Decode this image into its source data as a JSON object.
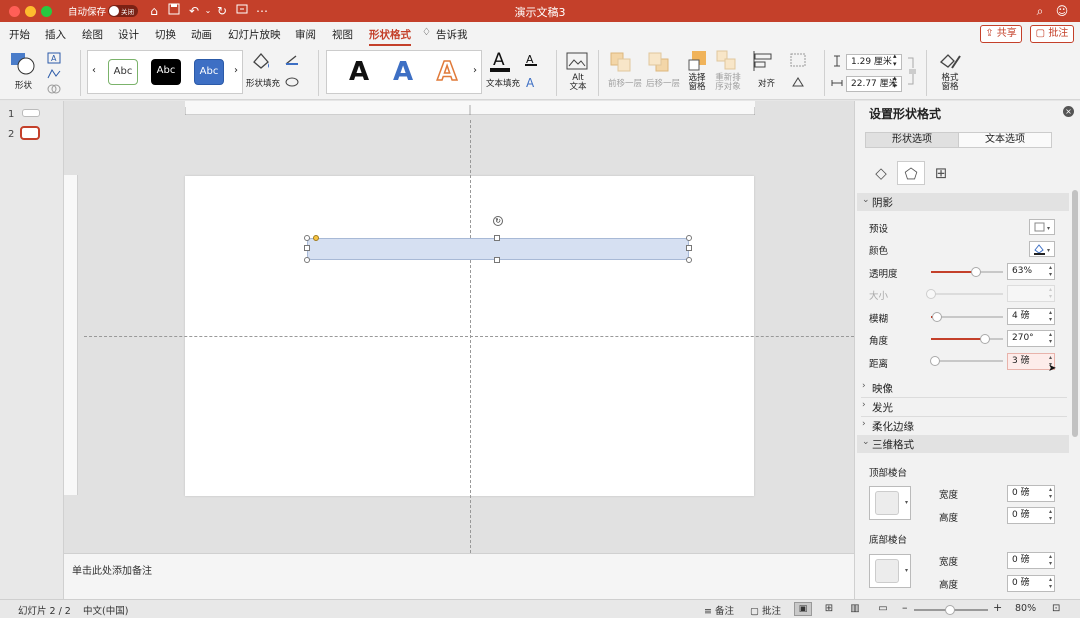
{
  "titlebar": {
    "autosave_label": "自动保存",
    "autosave_state": "关闭",
    "doc_title": "演示文稿3",
    "accent": "#c4402a"
  },
  "menu": {
    "tabs": [
      "开始",
      "插入",
      "绘图",
      "设计",
      "切换",
      "动画",
      "幻灯片放映",
      "审阅",
      "视图",
      "形状格式",
      "告诉我"
    ],
    "active": "形状格式",
    "share_label": "共享",
    "comment_label": "批注"
  },
  "ribbon": {
    "shape_label": "形状",
    "style_samples": [
      "Abc",
      "Abc",
      "Abc"
    ],
    "shape_fill_label": "形状填充",
    "wordart_letter": "A",
    "text_fill_label": "文本填充",
    "alt_text_label": "Alt 文本",
    "forward_label": "前移一层",
    "backward_label": "后移一层",
    "selection_pane_label": "选择 窗格",
    "reorder_label": "重新排 序对象",
    "align_label": "对齐",
    "height_value": "1.29 厘米",
    "width_value": "22.77 厘米",
    "format_pane_label": "格式 窗格"
  },
  "thumbnails": {
    "slides": [
      "1",
      "2"
    ]
  },
  "notes": {
    "placeholder": "单击此处添加备注"
  },
  "status": {
    "slide_info": "幻灯片 2 / 2",
    "language": "中文(中国)",
    "notes_label": "备注",
    "comments_label": "批注",
    "zoom": "80%",
    "zoom_fraction": 0.48
  },
  "panel": {
    "title": "设置形状格式",
    "segments": [
      "形状选项",
      "文本选项"
    ],
    "shadow": {
      "title": "阴影",
      "preset_label": "预设",
      "color_label": "颜色",
      "transparency_label": "透明度",
      "transparency_value": "63%",
      "transparency_fraction": 0.63,
      "size_label": "大小",
      "size_value": "",
      "size_fraction": 0,
      "blur_label": "模糊",
      "blur_value": "4 磅",
      "blur_fraction": 0.08,
      "angle_label": "角度",
      "angle_value": "270°",
      "angle_fraction": 0.75,
      "distance_label": "距离",
      "distance_value": "3 磅",
      "distance_fraction": 0.06
    },
    "collapsed_sections": [
      "映像",
      "发光",
      "柔化边缘"
    ],
    "three_d": {
      "title": "三维格式",
      "top_bevel_label": "顶部棱台",
      "bottom_bevel_label": "底部棱台",
      "width_label": "宽度",
      "height_label": "高度",
      "top_width_value": "0 磅",
      "top_height_value": "0 磅",
      "bottom_width_value": "0 磅",
      "bottom_height_value": "0 磅"
    }
  }
}
